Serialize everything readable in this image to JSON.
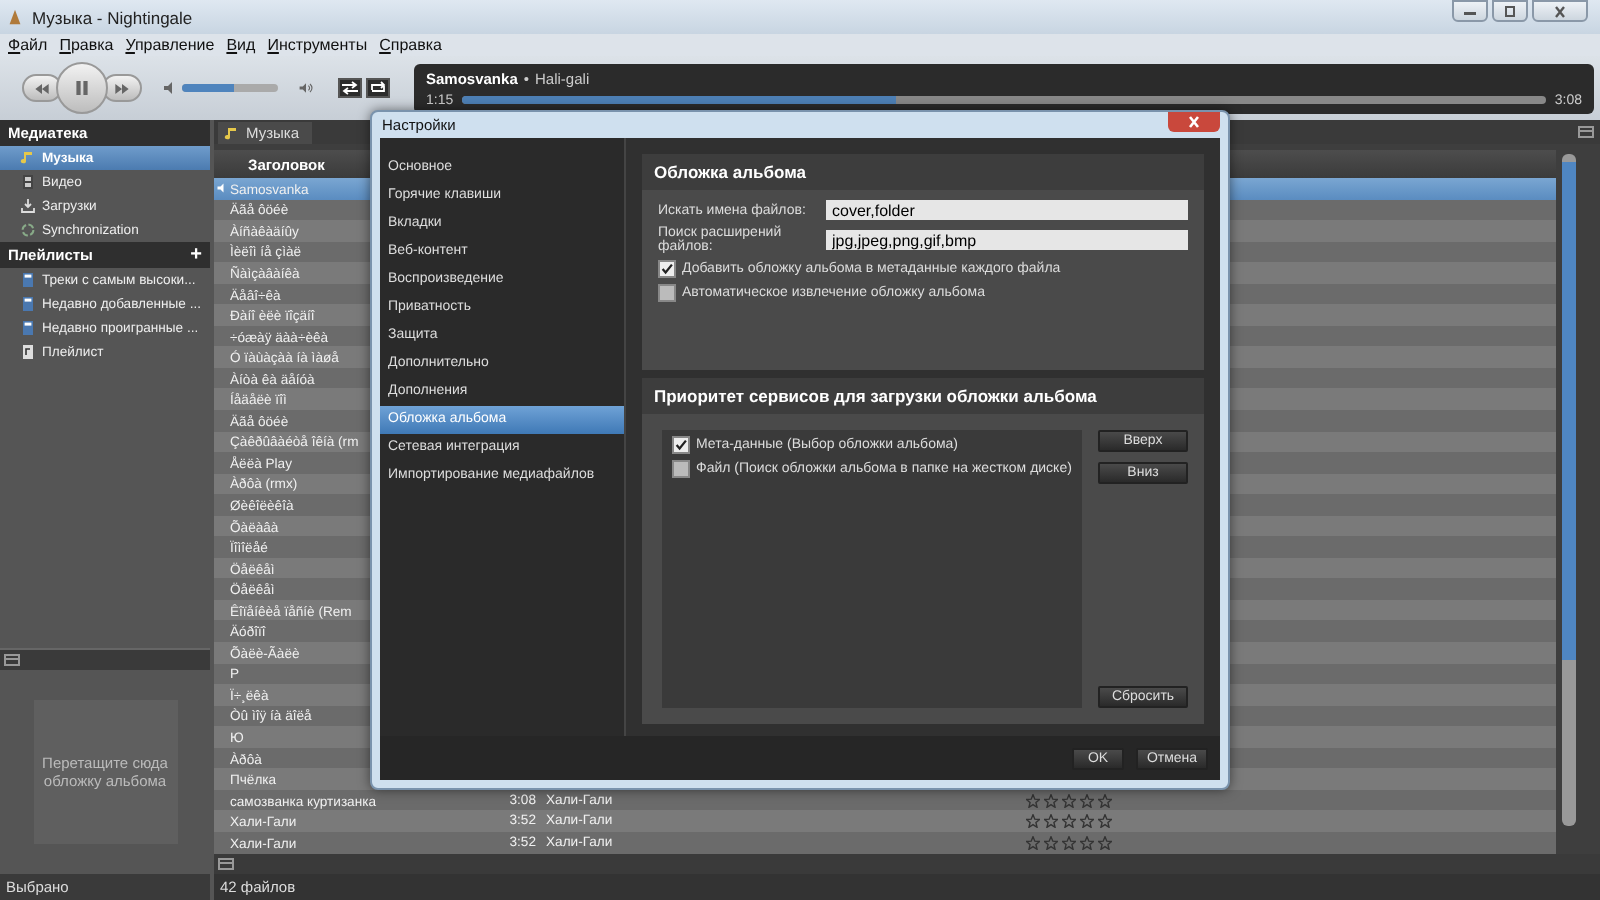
{
  "window": {
    "title": "Музыка - Nightingale"
  },
  "menu": [
    "Файл",
    "Правка",
    "Управление",
    "Вид",
    "Инструменты",
    "Справка"
  ],
  "player": {
    "track_title": "Samosvanka",
    "separator": "•",
    "track_artist": "Hali-gali",
    "elapsed": "1:15",
    "total": "3:08",
    "progress": {
      "level": 0.4
    },
    "volume": {
      "level": 0.55
    }
  },
  "sidebar": {
    "library_header": "Медиатека",
    "library_items": [
      {
        "label": "Музыка",
        "kind": "music",
        "selected": true
      },
      {
        "label": "Видео",
        "kind": "video",
        "selected": false
      },
      {
        "label": "Загрузки",
        "kind": "download",
        "selected": false
      },
      {
        "label": "Synchronization",
        "kind": "sync",
        "selected": false
      }
    ],
    "playlists_header": "Плейлисты",
    "add_button": "+",
    "playlists": [
      {
        "label": "Треки с самым высоки...",
        "kind": "smart",
        "selected": false
      },
      {
        "label": "Недавно добавленные ...",
        "kind": "smart",
        "selected": false
      },
      {
        "label": "Недавно проигранные ...",
        "kind": "smart",
        "selected": false
      },
      {
        "label": "Плейлист",
        "kind": "playlist",
        "selected": false
      }
    ],
    "cover_drop_hint": "Перетащите сюда обложку альбома",
    "status": "Выбрано"
  },
  "tracklist": {
    "tab": "Музыка",
    "column_title": "Заголовок",
    "status": "42 файлов",
    "rows": [
      {
        "title": "Samosvanka",
        "playing": true,
        "selected": true
      },
      {
        "title": "Äãå ôöéè",
        "playing": false,
        "selected": false
      },
      {
        "title": "Àíñàêàäíûy",
        "playing": false,
        "selected": false
      },
      {
        "title": "Ìèëîì íå çìàë",
        "playing": false,
        "selected": false
      },
      {
        "title": "Ñàìçàâàíêà",
        "playing": false,
        "selected": false
      },
      {
        "title": "Äåâî÷êà",
        "playing": false,
        "selected": false
      },
      {
        "title": "Ðàíî èëè ïîçäíî",
        "playing": false,
        "selected": false
      },
      {
        "title": "÷óæàÿ äàà÷èêà",
        "playing": false,
        "selected": false
      },
      {
        "title": "Ó ïàùàçàà íà ìàøå",
        "playing": false,
        "selected": false
      },
      {
        "title": "Àíòà êà äåíóà",
        "playing": false,
        "selected": false
      },
      {
        "title": "Íåäåëè ïîì",
        "playing": false,
        "selected": false
      },
      {
        "title": "Äãå ôöéè",
        "playing": false,
        "selected": false
      },
      {
        "title": "Çàêðûâàéòå îêíà (rm",
        "playing": false,
        "selected": false
      },
      {
        "title": "Åëëà Play",
        "playing": false,
        "selected": false
      },
      {
        "title": "Àðôà (rmx)",
        "playing": false,
        "selected": false
      },
      {
        "title": "Øèêîëèêîà",
        "playing": false,
        "selected": false
      },
      {
        "title": "Õàëàâà",
        "playing": false,
        "selected": false
      },
      {
        "title": "Ïîìîëåé",
        "playing": false,
        "selected": false
      },
      {
        "title": "Öåëêåì",
        "playing": false,
        "selected": false
      },
      {
        "title": "Öåëêåì",
        "playing": false,
        "selected": false
      },
      {
        "title": "Êîïåíêèå ïåñíè (Rem",
        "playing": false,
        "selected": false
      },
      {
        "title": "Äóðîïî",
        "playing": false,
        "selected": false
      },
      {
        "title": "Õàëè-Ãàëè",
        "playing": false,
        "selected": false
      },
      {
        "title": "P",
        "playing": false,
        "selected": false
      },
      {
        "title": "Ï÷¸ëêà",
        "playing": false,
        "selected": false
      },
      {
        "title": "Òû ìîÿ íà äîëå",
        "playing": false,
        "selected": false
      },
      {
        "title": "Ю",
        "playing": false,
        "selected": false
      },
      {
        "title": "Àðôà",
        "playing": false,
        "selected": false
      },
      {
        "title": "Пчёлка",
        "playing": false,
        "selected": false
      },
      {
        "title": "самозванка куртизанка",
        "duration": "3:08",
        "artist": "Хали-Гали",
        "stars": 0,
        "playing": false,
        "selected": false
      },
      {
        "title": "Хали-Гали",
        "duration": "3:52",
        "artist": "Хали-Гали",
        "stars": 0,
        "playing": false,
        "selected": false
      },
      {
        "title": "Хали-Гали",
        "duration": "3:52",
        "artist": "Хали-Гали",
        "stars": 0,
        "playing": false,
        "selected": false
      }
    ]
  },
  "dialog": {
    "title": "Настройки",
    "nav": [
      {
        "label": "Основное",
        "selected": false
      },
      {
        "label": "Горячие клавиши",
        "selected": false
      },
      {
        "label": "Вкладки",
        "selected": false
      },
      {
        "label": "Веб-контент",
        "selected": false
      },
      {
        "label": "Воспроизведение",
        "selected": false
      },
      {
        "label": "Приватность",
        "selected": false
      },
      {
        "label": "Защита",
        "selected": false
      },
      {
        "label": "Дополнительно",
        "selected": false
      },
      {
        "label": "Дополнения",
        "selected": false
      },
      {
        "label": "Обложка альбома",
        "selected": true
      },
      {
        "label": "Сетевая интеграция",
        "selected": false
      },
      {
        "label": "Импортирование медиафайлов",
        "selected": false
      }
    ],
    "section_title": "Обложка альбома",
    "fields": [
      {
        "label": "Искать имена файлов:",
        "value": "cover,folder"
      },
      {
        "label": "Поиск расширений файлов:",
        "value": "jpg,jpeg,png,gif,bmp"
      }
    ],
    "options": [
      {
        "label": "Добавить обложку альбома в метаданные каждого файла",
        "checked": true
      },
      {
        "label": "Автоматическое извлечение обложку альбома",
        "checked": false
      }
    ],
    "priority_title": "Приоритет сервисов для загрузки обложки альбома",
    "services": [
      {
        "label": "Мета-данные (Выбор обложки альбома)",
        "checked": true
      },
      {
        "label": "Файл (Поиск обложки альбома в папке на жестком диске)",
        "checked": false
      }
    ],
    "side_buttons": [
      "Вверх",
      "Вниз"
    ],
    "reset_button": "Сбросить",
    "buttons": [
      "OK",
      "Отмена"
    ]
  }
}
